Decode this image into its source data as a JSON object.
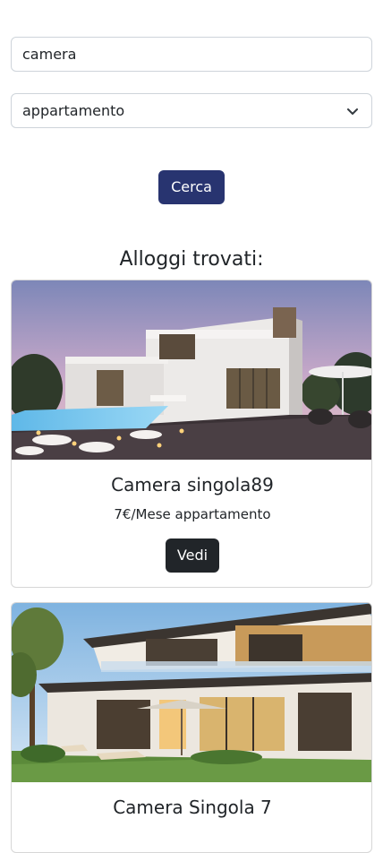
{
  "search": {
    "value": "camera"
  },
  "type_select": {
    "selected": "appartamento"
  },
  "search_button": {
    "label": "Cerca"
  },
  "results": {
    "title": "Alloggi trovati:",
    "cards": [
      {
        "title": "Camera singola89",
        "subtitle": "7€/Mese appartamento",
        "button": "Vedi"
      },
      {
        "title": "Camera Singola 7"
      }
    ]
  },
  "colors": {
    "primary": "#283470",
    "dark_button": "#212529"
  },
  "icons": {
    "select_arrow": "chevron-down-icon"
  }
}
